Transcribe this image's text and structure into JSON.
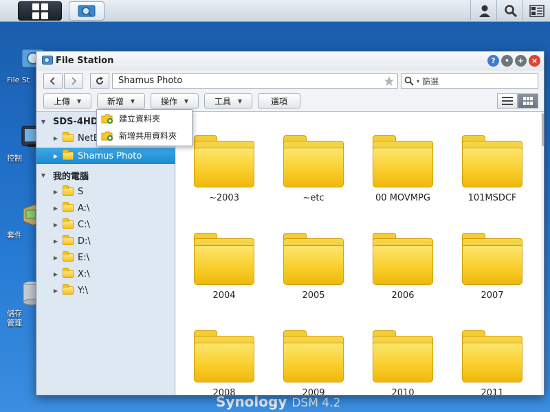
{
  "taskbar": {
    "main_menu_icon": "grid-icon",
    "file_station_icon": "file-station-icon",
    "user_icon": "user-icon",
    "search_icon": "search-icon",
    "widgets_icon": "widgets-icon"
  },
  "desktop": {
    "icons": [
      {
        "label": "File St",
        "icon": "file-station-icon"
      },
      {
        "label": "控制",
        "icon": "control-panel-icon"
      },
      {
        "label": "套件",
        "icon": "package-center-icon"
      },
      {
        "label": "儲存",
        "label2": "管理",
        "icon": "storage-manager-icon"
      }
    ],
    "footer_brand": "Synology",
    "footer_product": "DSM 4.2"
  },
  "window": {
    "title": "File Station",
    "path": "Shamus Photo",
    "filter_placeholder": "篩選",
    "toolbar": {
      "upload": "上傳",
      "create": "新增",
      "action": "操作",
      "tools": "工具",
      "settings": "選項"
    },
    "create_menu": [
      {
        "label": "建立資料夾"
      },
      {
        "label": "新增共用資料夾"
      }
    ],
    "tree": {
      "server": "SDS-4HD",
      "netbackup": "NetB",
      "selected": "Shamus Photo",
      "my_computer": "我的電腦",
      "drives": [
        "S",
        "A:\\",
        "C:\\",
        "D:\\",
        "E:\\",
        "X:\\",
        "Y:\\"
      ]
    },
    "files": [
      "~2003",
      "~etc",
      "00 MOVMPG",
      "101MSDCF",
      "2004",
      "2005",
      "2006",
      "2007",
      "2008",
      "2009",
      "2010",
      "2011"
    ]
  },
  "colors": {
    "desktop_bg": "#1f6cc4",
    "selected_row": "#1b8bd3",
    "folder_yellow": "#f9cf2c"
  }
}
